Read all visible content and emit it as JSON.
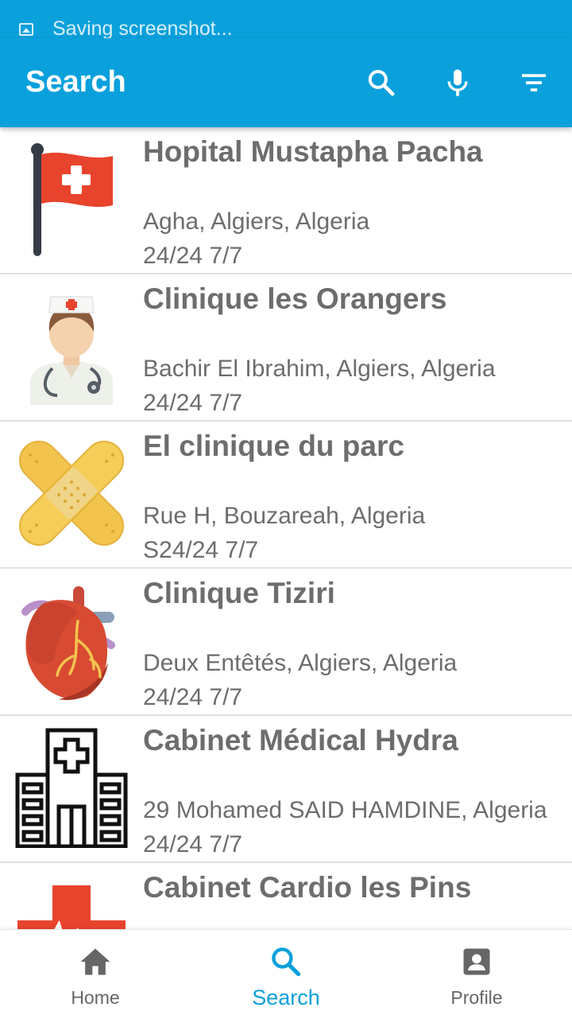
{
  "status_bar": {
    "notification": "Saving screenshot..."
  },
  "appbar": {
    "title": "Search",
    "actions": [
      "search-icon",
      "microphone-icon",
      "filter-icon"
    ]
  },
  "colors": {
    "primary": "#0aa0dc",
    "text": "#6d6d6d"
  },
  "results": [
    {
      "name": "Hopital Mustapha Pacha",
      "address": "Agha, Algiers, Algeria",
      "hours": "24/24 7/7",
      "icon": "hospital-flag-icon"
    },
    {
      "name": "Clinique les Orangers",
      "address": "Bachir El Ibrahim, Algiers, Algeria",
      "hours": "24/24 7/7",
      "icon": "nurse-icon"
    },
    {
      "name": "El clinique du parc",
      "address": "Rue H, Bouzareah, Algeria",
      "hours": "S24/24 7/7",
      "icon": "bandage-icon"
    },
    {
      "name": "Clinique Tiziri",
      "address": "Deux Entêtés, Algiers, Algeria",
      "hours": "24/24 7/7",
      "icon": "heart-icon"
    },
    {
      "name": "Cabinet Médical Hydra",
      "address": "29 Mohamed SAID HAMDINE, Algeria",
      "hours": "24/24 7/7",
      "icon": "hospital-building-icon"
    },
    {
      "name": "Cabinet Cardio les Pins",
      "address": "",
      "hours": "",
      "icon": "medical-cross-icon"
    }
  ],
  "bottom_nav": {
    "items": [
      {
        "label": "Home",
        "icon": "home-icon"
      },
      {
        "label": "Search",
        "icon": "search-icon",
        "active": true
      },
      {
        "label": "Profile",
        "icon": "profile-icon"
      }
    ]
  }
}
